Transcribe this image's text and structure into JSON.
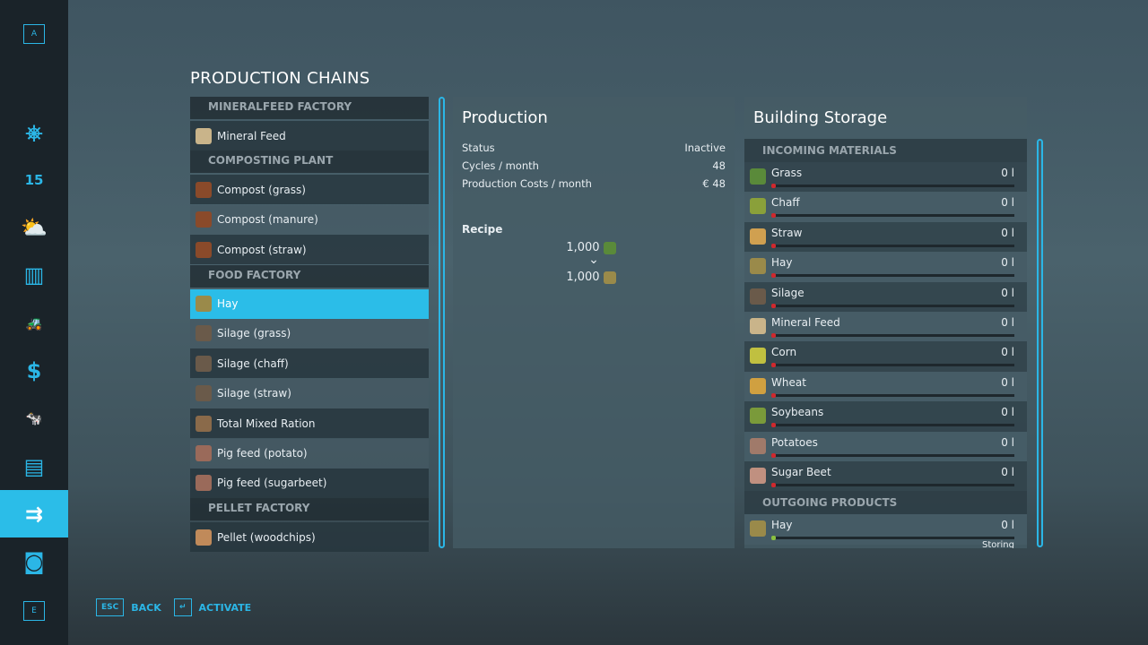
{
  "sidebar": {
    "top_key": "A",
    "bottom_key": "E",
    "items": [
      {
        "icon": "steering-wheel-icon",
        "glyph": "⎈"
      },
      {
        "icon": "calendar-icon",
        "glyph": "15"
      },
      {
        "icon": "weather-icon",
        "glyph": "⛅"
      },
      {
        "icon": "statistics-icon",
        "glyph": "▥"
      },
      {
        "icon": "tractor-icon",
        "glyph": "🚜"
      },
      {
        "icon": "finances-icon",
        "glyph": "$"
      },
      {
        "icon": "animals-icon",
        "glyph": "🐄"
      },
      {
        "icon": "contracts-icon",
        "glyph": "▤"
      },
      {
        "icon": "production-icon",
        "glyph": "⇉",
        "selected": true
      },
      {
        "icon": "tutorial-icon",
        "glyph": "◙"
      }
    ]
  },
  "title": "PRODUCTION CHAINS",
  "list": [
    {
      "header": "MINERALFEED FACTORY"
    },
    {
      "label": "Mineral Feed",
      "color": "#c9b48a"
    },
    {
      "header": "COMPOSTING PLANT"
    },
    {
      "label": "Compost (grass)",
      "color": "#8a4a2a"
    },
    {
      "label": "Compost (manure)",
      "color": "#8a4a2a"
    },
    {
      "label": "Compost (straw)",
      "color": "#8a4a2a"
    },
    {
      "header": "FOOD FACTORY"
    },
    {
      "label": "Hay",
      "color": "#9a8a4a",
      "selected": true
    },
    {
      "label": "Silage (grass)",
      "color": "#6a5a4a"
    },
    {
      "label": "Silage (chaff)",
      "color": "#6a5a4a"
    },
    {
      "label": "Silage (straw)",
      "color": "#6a5a4a"
    },
    {
      "label": "Total Mixed Ration",
      "color": "#8a6a4a"
    },
    {
      "label": "Pig feed (potato)",
      "color": "#9a6a5a"
    },
    {
      "label": "Pig feed (sugarbeet)",
      "color": "#9a6a5a"
    },
    {
      "header": "PELLET FACTORY"
    },
    {
      "label": "Pellet (woodchips)",
      "color": "#c08a5a"
    }
  ],
  "production": {
    "title": "Production",
    "rows": [
      {
        "k": "Status",
        "v": "Inactive"
      },
      {
        "k": "Cycles / month",
        "v": "48"
      },
      {
        "k": "Production Costs / month",
        "v": "€ 48"
      }
    ],
    "recipe_label": "Recipe",
    "input": "1,000",
    "output": "1,000"
  },
  "storage": {
    "title": "Building Storage",
    "incoming_header": "INCOMING MATERIALS",
    "incoming": [
      {
        "name": "Grass",
        "value": "0 l",
        "color": "#5a8a3a"
      },
      {
        "name": "Chaff",
        "value": "0 l",
        "color": "#8aa03a"
      },
      {
        "name": "Straw",
        "value": "0 l",
        "color": "#d0a050"
      },
      {
        "name": "Hay",
        "value": "0 l",
        "color": "#9a8a4a"
      },
      {
        "name": "Silage",
        "value": "0 l",
        "color": "#6a5a4a"
      },
      {
        "name": "Mineral Feed",
        "value": "0 l",
        "color": "#c9b48a"
      },
      {
        "name": "Corn",
        "value": "0 l",
        "color": "#c0c040"
      },
      {
        "name": "Wheat",
        "value": "0 l",
        "color": "#d0a040"
      },
      {
        "name": "Soybeans",
        "value": "0 l",
        "color": "#7a9a3a"
      },
      {
        "name": "Potatoes",
        "value": "0 l",
        "color": "#a07a6a"
      },
      {
        "name": "Sugar Beet",
        "value": "0 l",
        "color": "#c09080"
      }
    ],
    "outgoing_header": "OUTGOING PRODUCTS",
    "outgoing": [
      {
        "name": "Hay",
        "value": "0 l",
        "color": "#9a8a4a",
        "mode": "Storing"
      }
    ]
  },
  "footer": {
    "back_key": "ESC",
    "back": "BACK",
    "activate_key": "↵",
    "activate": "ACTIVATE"
  },
  "colors": {
    "accent": "#2bbde8",
    "fill_empty_in": "#d0282d",
    "fill_out": "#8ac040"
  }
}
